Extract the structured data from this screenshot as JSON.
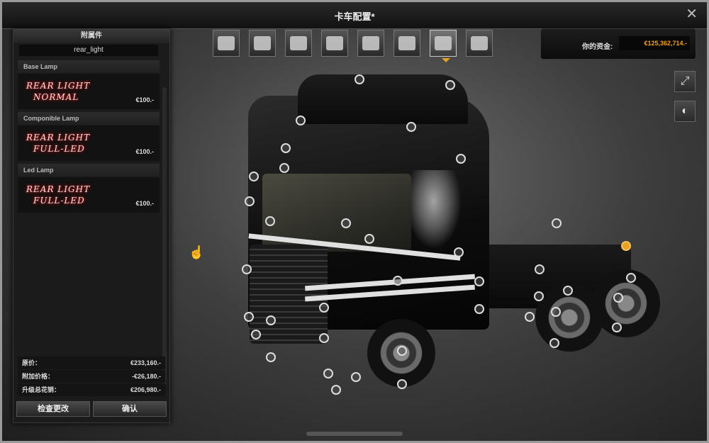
{
  "window": {
    "title": "卡车配置*"
  },
  "left_panel": {
    "header": "附属件",
    "selected_part": "rear_light",
    "categories": [
      {
        "name": "Base Lamp",
        "item": {
          "line1": "REAR LIGHT",
          "line2": "NORMAL",
          "price": "€100.-"
        }
      },
      {
        "name": "Componible Lamp",
        "item": {
          "line1": "REAR LIGHT",
          "line2": "FULL-LED",
          "price": "€100.-"
        }
      },
      {
        "name": "Led Lamp",
        "item": {
          "line1": "REAR LIGHT",
          "line2": "FULL-LED",
          "price": "€100.-"
        }
      }
    ],
    "summary": {
      "original_label": "原价：",
      "original_value": "€233,160.-",
      "extra_label": "附加价格：",
      "extra_value": "-€26,180.-",
      "total_label": "升级总花销：",
      "total_value": "€206,980.-"
    },
    "buttons": {
      "review": "检查更改",
      "confirm": "确认"
    }
  },
  "tabs": [
    {
      "icon": "truck-front-icon"
    },
    {
      "icon": "chassis-icon"
    },
    {
      "icon": "engine-icon"
    },
    {
      "icon": "transmission-icon"
    },
    {
      "icon": "cabin-interior-icon"
    },
    {
      "icon": "truck-side-icon"
    },
    {
      "icon": "accessories-icon",
      "active": true
    },
    {
      "icon": "paint-icon"
    }
  ],
  "money": {
    "label": "你的资金:",
    "value": "€125,362,714.-",
    "color": "#f0a020"
  },
  "side_buttons": {
    "fullscreen_icon": "fullscreen-icon",
    "lights_icon": "headlight-icon"
  },
  "accent_color": "#e8a020"
}
